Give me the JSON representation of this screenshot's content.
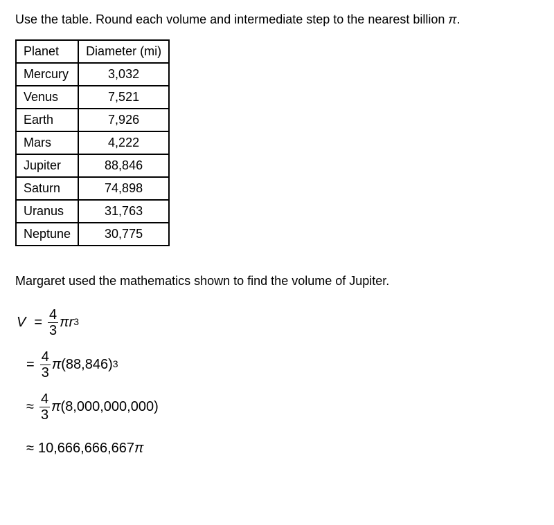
{
  "instruction": "Use the table. Round each volume and intermediate step to the nearest billion π.",
  "table": {
    "headers": {
      "planet": "Planet",
      "diameter": "Diameter (mi)"
    },
    "rows": [
      {
        "planet": "Mercury",
        "diameter": "3,032"
      },
      {
        "planet": "Venus",
        "diameter": "7,521"
      },
      {
        "planet": "Earth",
        "diameter": "7,926"
      },
      {
        "planet": "Mars",
        "diameter": "4,222"
      },
      {
        "planet": "Jupiter",
        "diameter": "88,846"
      },
      {
        "planet": "Saturn",
        "diameter": "74,898"
      },
      {
        "planet": "Uranus",
        "diameter": "31,763"
      },
      {
        "planet": "Neptune",
        "diameter": "30,775"
      }
    ]
  },
  "statement": "Margaret used the mathematics shown to find the volume of Jupiter.",
  "math": {
    "line1": {
      "V": "V",
      "eq": "=",
      "frac_num": "4",
      "frac_den": "3",
      "pi": "π",
      "r": "r",
      "exp": "3"
    },
    "line2": {
      "eq": "=",
      "frac_num": "4",
      "frac_den": "3",
      "pi": "π",
      "lparen": "(",
      "value": "88,846",
      "rparen": ")",
      "exp": "3"
    },
    "line3": {
      "approx": "≈",
      "frac_num": "4",
      "frac_den": "3",
      "pi": "π",
      "lparen": "(",
      "value": "8,000,000,000",
      "rparen": ")"
    },
    "line4": {
      "approx": "≈",
      "value": "10,666,666,667",
      "pi": "π"
    }
  }
}
